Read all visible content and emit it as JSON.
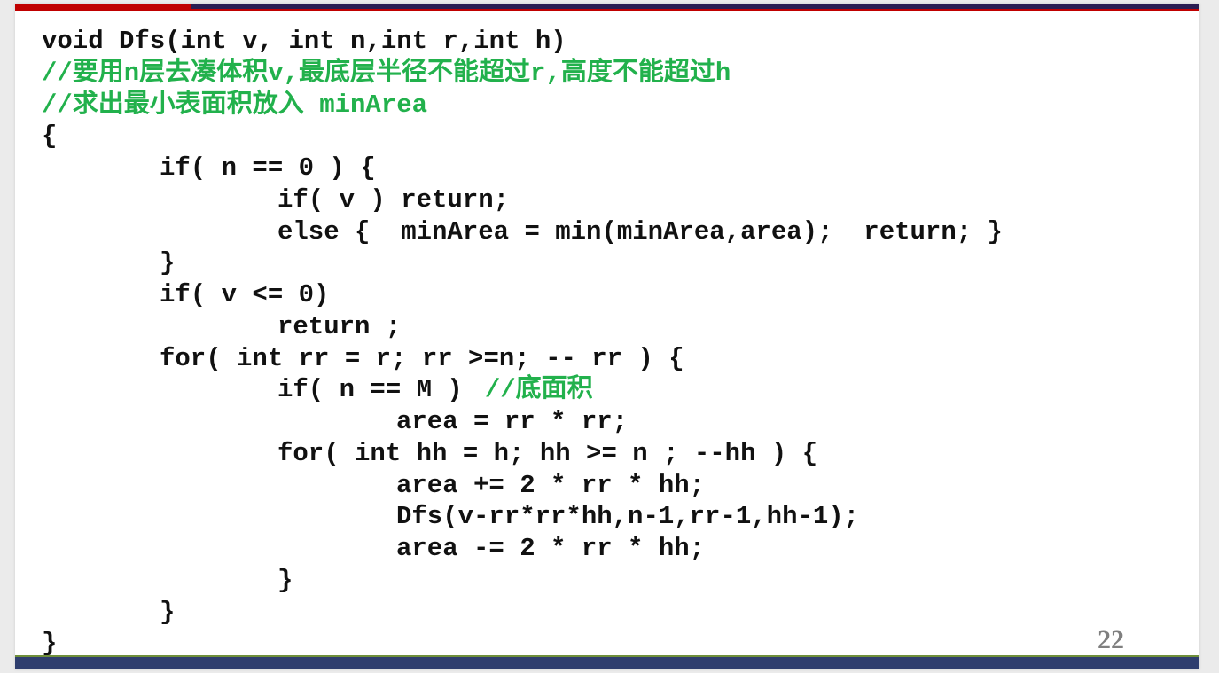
{
  "colors": {
    "code": "#111111",
    "comment": "#22b14c",
    "page_number": "#7f7f7f",
    "top_bar_left": "#c00000",
    "top_bar_right": "#2a1d52",
    "bottom_bar": "#2f3e6e",
    "bottom_line": "#6f8f3a"
  },
  "code": {
    "lines": [
      {
        "text": "void Dfs(int v, int n,int r,int h)"
      },
      {
        "comment": "//要用n层去凑体积v,最底层半径不能超过r,高度不能超过h"
      },
      {
        "comment": "//求出最小表面积放入 minArea"
      },
      {
        "text": "{"
      },
      {
        "text": "if( n == 0 ) {"
      },
      {
        "text": "if( v ) return;"
      },
      {
        "text": "else {  minArea = min(minArea,area);  return; }"
      },
      {
        "text": "}"
      },
      {
        "text": "if( v <= 0)"
      },
      {
        "text": "return ;"
      },
      {
        "text": "for( int rr = r; rr >=n; -- rr ) {"
      },
      {
        "text": "if( n == M )",
        "comment": "//底面积"
      },
      {
        "text": "area = rr * rr;"
      },
      {
        "text": "for( int hh = h; hh >= n ; --hh ) {"
      },
      {
        "text": "area += 2 * rr * hh;"
      },
      {
        "text": "Dfs(v-rr*rr*hh,n-1,rr-1,hh-1);"
      },
      {
        "text": "area -= 2 * rr * hh;"
      },
      {
        "text": "}"
      },
      {
        "text": "}"
      },
      {
        "text": "}"
      }
    ]
  },
  "page_number": "22"
}
